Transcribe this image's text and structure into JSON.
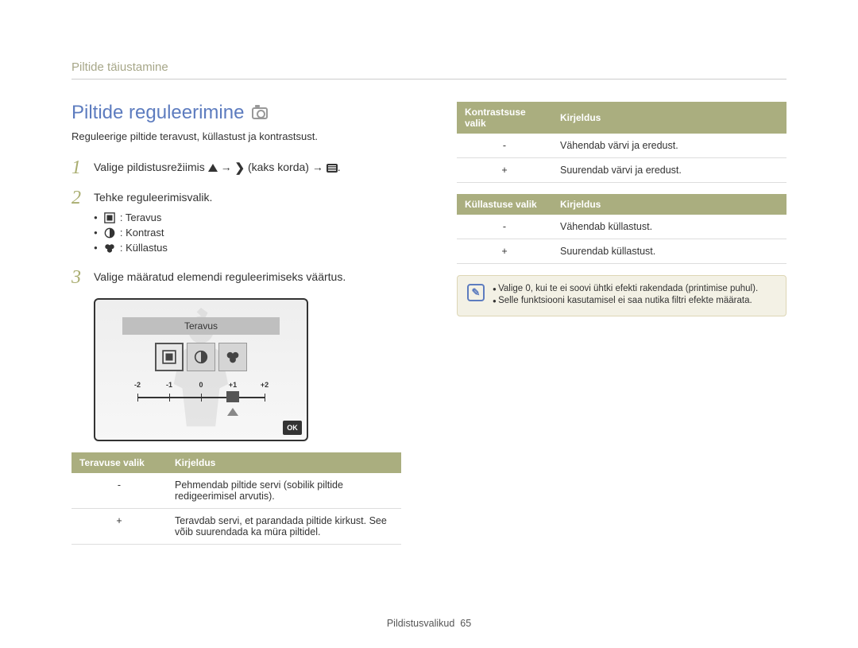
{
  "breadcrumb": "Piltide täiustamine",
  "title": "Piltide reguleerimine",
  "intro": "Reguleerige piltide teravust, küllastust ja kontrastsust.",
  "steps": {
    "s1_a": "Valige pildistusrežiimis ",
    "s1_b": " (kaks korda) ",
    "arrow": "→",
    "s2": "Tehke reguleerimisvalik.",
    "sub": [
      {
        "label": ": Teravus"
      },
      {
        "label": ": Kontrast"
      },
      {
        "label": ": Küllastus"
      }
    ],
    "s3": "Valige määratud elemendi reguleerimiseks väärtus."
  },
  "screen": {
    "banner": "Teravus",
    "scale": [
      "-2",
      "-1",
      "0",
      "+1",
      "+2"
    ],
    "ok": "OK"
  },
  "tables": {
    "teravus": {
      "h1": "Teravuse valik",
      "h2": "Kirjeldus",
      "rows": [
        {
          "k": "-",
          "v": "Pehmendab piltide servi (sobilik piltide redigeerimisel arvutis)."
        },
        {
          "k": "+",
          "v": "Teravdab servi, et parandada piltide kirkust. See võib suurendada ka müra piltidel."
        }
      ]
    },
    "kontrast": {
      "h1": "Kontrastsuse valik",
      "h2": "Kirjeldus",
      "rows": [
        {
          "k": "-",
          "v": "Vähendab värvi ja eredust."
        },
        {
          "k": "+",
          "v": "Suurendab värvi ja eredust."
        }
      ]
    },
    "kyllastus": {
      "h1": "Küllastuse valik",
      "h2": "Kirjeldus",
      "rows": [
        {
          "k": "-",
          "v": "Vähendab küllastust."
        },
        {
          "k": "+",
          "v": "Suurendab küllastust."
        }
      ]
    }
  },
  "note": {
    "lines": [
      "Valige 0, kui te ei soovi ühtki efekti rakendada (printimise puhul).",
      "Selle funktsiooni kasutamisel ei saa nutika filtri efekte määrata."
    ]
  },
  "footer": {
    "section": "Pildistusvalikud",
    "page": "65"
  }
}
